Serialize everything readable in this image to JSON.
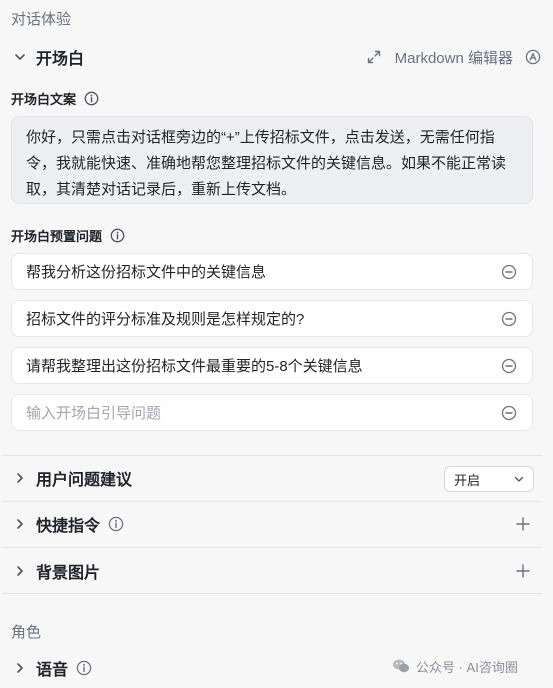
{
  "section_dialog": "对话体验",
  "opening": {
    "title": "开场白",
    "markdown_label": "Markdown 编辑器",
    "copy_label": "开场白文案",
    "copy_text": "你好，只需点击对话框旁边的“+”上传招标文件，点击发送，无需任何指令，我就能快速、准确地帮您整理招标文件的关键信息。如果不能正常读取，其清楚对话记录后，重新上传文档。",
    "preset_label": "开场白预置问题",
    "questions": [
      "帮我分析这份招标文件中的关键信息",
      "招标文件的评分标准及规则是怎样规定的?",
      "请帮我整理出这份招标文件最重要的5-8个关键信息"
    ],
    "question_placeholder": "输入开场白引导问题"
  },
  "user_suggestions": {
    "title": "用户问题建议",
    "select_value": "开启"
  },
  "shortcuts": {
    "title": "快捷指令"
  },
  "background": {
    "title": "背景图片"
  },
  "section_role": "角色",
  "voice": {
    "title": "语音"
  },
  "watermark": "公众号 · AI咨询圈",
  "colors": {
    "background": "#f7f7f8",
    "card": "#ffffff",
    "text_box": "#eeeff1",
    "muted": "#6b7280",
    "border": "#e6e7eb"
  }
}
